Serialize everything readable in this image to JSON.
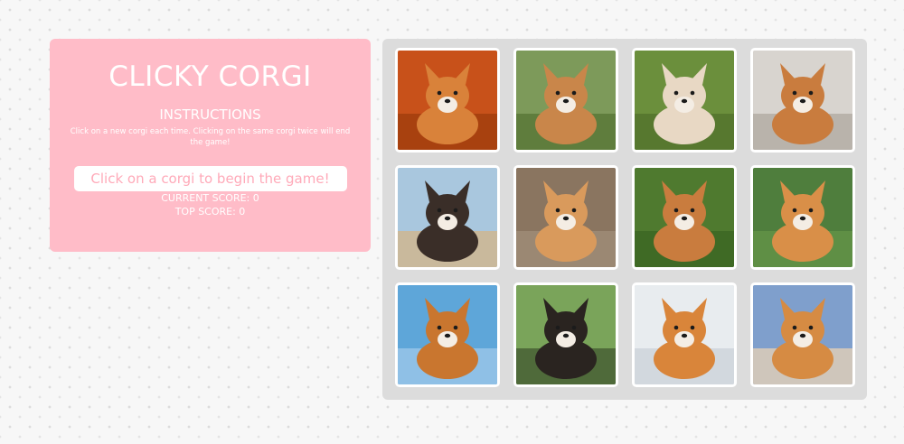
{
  "header": {
    "title": "CLICKY CORGI",
    "instructions_heading": "INSTRUCTIONS",
    "instructions_text": "Click on a new corgi each time. Clicking on the same corgi twice will end the game!",
    "message": "Click on a corgi to begin the game!",
    "current_score_label": "CURRENT SCORE: 0",
    "top_score_label": "TOP SCORE: 0"
  },
  "colors": {
    "panel_bg": "#ffbcc8",
    "message_text": "#ffaab9",
    "board_bg": "#dcdcdc"
  },
  "cards": [
    {
      "id": "corgi-autumn-leaves",
      "bg": "#c8511a",
      "ground": "#a8410f",
      "fur": "#d9823a"
    },
    {
      "id": "corgi-graduation-cap",
      "bg": "#7d9a5a",
      "ground": "#5f7d3d",
      "fur": "#c9864a"
    },
    {
      "id": "corgi-upside-down-grass",
      "bg": "#6b8f3c",
      "ground": "#57782f",
      "fur": "#e8d8c4"
    },
    {
      "id": "corgi-sitting-floor",
      "bg": "#d8d4cf",
      "ground": "#b9b3ab",
      "fur": "#c97c3e"
    },
    {
      "id": "corgi-beach-flower-collar",
      "bg": "#a9c7de",
      "ground": "#c9b99c",
      "fur": "#3a2e28"
    },
    {
      "id": "corgi-puppy-standing",
      "bg": "#8a7560",
      "ground": "#9b8873",
      "fur": "#d99a5c"
    },
    {
      "id": "corgi-waldo-costume",
      "bg": "#4f7a2f",
      "ground": "#3f6a25",
      "fur": "#c97c3e"
    },
    {
      "id": "corgi-jumping-park",
      "bg": "#4f7e3d",
      "ground": "#5f8f45",
      "fur": "#d98f48"
    },
    {
      "id": "corgi-blue-sky",
      "bg": "#5ea6d9",
      "ground": "#8fc0e6",
      "fur": "#c9762f"
    },
    {
      "id": "corgi-tricolor-closeup",
      "bg": "#7aa45a",
      "ground": "#4f6a3a",
      "fur": "#2a2420"
    },
    {
      "id": "corgi-running-snow",
      "bg": "#e8ecef",
      "ground": "#d2d8de",
      "fur": "#d9853a"
    },
    {
      "id": "corgi-under-blanket",
      "bg": "#7f9fcc",
      "ground": "#cfc6bb",
      "fur": "#d68b43"
    }
  ]
}
